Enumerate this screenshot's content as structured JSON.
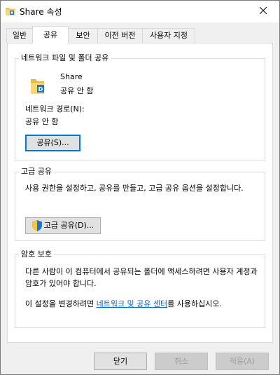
{
  "window": {
    "title": "Share 속성"
  },
  "tabs": [
    {
      "label": "일반",
      "active": false
    },
    {
      "label": "공유",
      "active": true
    },
    {
      "label": "보안",
      "active": false
    },
    {
      "label": "이전 버전",
      "active": false
    },
    {
      "label": "사용자 지정",
      "active": false
    }
  ],
  "network_share": {
    "title": "네트워크 파일 및 폴더 공유",
    "folder_name": "Share",
    "folder_status": "공유 안 함",
    "path_label": "네트워크 경로(N):",
    "path_value": "공유 안 함",
    "share_button": "공유(S)..."
  },
  "advanced_share": {
    "title": "고급 공유",
    "description": "사용 권한을 설정하고, 공유를 만들고, 고급 공유 옵션을 설정합니다.",
    "button": "고급 공유(D)..."
  },
  "password": {
    "title": "암호 보호",
    "description": "다른 사람이 이 컴퓨터에서 공유되는 폴더에 액세스하려면 사용자 계정과 암호가 있어야 합니다.",
    "instruction_prefix": "이 설정을 변경하려면 ",
    "link": "네트워크 및 공유 센터",
    "instruction_suffix": "를 사용하십시오."
  },
  "footer": {
    "close": "닫기",
    "cancel": "취소",
    "apply": "적용(A)"
  },
  "colors": {
    "accent": "#0078d7",
    "link": "#0066cc",
    "folder": "#f4c542"
  }
}
